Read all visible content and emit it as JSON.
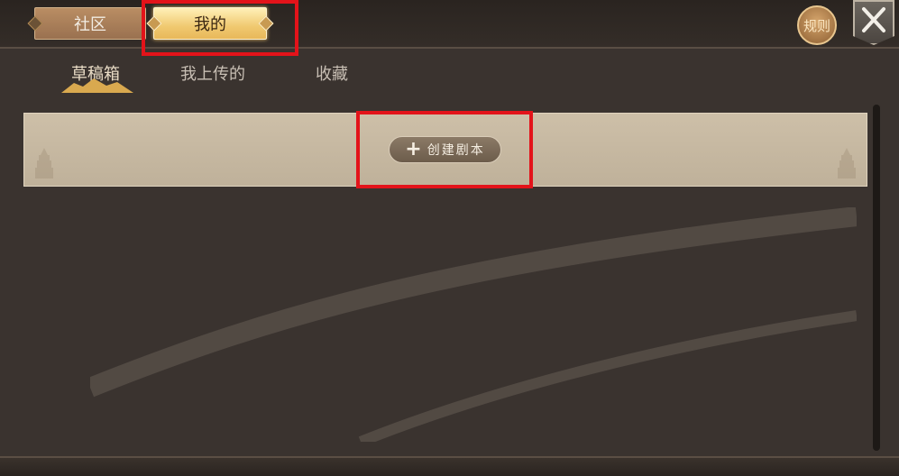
{
  "top_tabs": {
    "community": "社区",
    "mine": "我的"
  },
  "rules_label": "规则",
  "sub_tabs": {
    "drafts": "草稿箱",
    "uploaded": "我上传的",
    "favorites": "收藏"
  },
  "draft_card": {
    "create_label": "创建剧本"
  },
  "icons": {
    "close": "close-icon",
    "plus": "plus-icon"
  },
  "colors": {
    "highlight_box": "#e3131a",
    "active_tab": "#f0c970"
  }
}
